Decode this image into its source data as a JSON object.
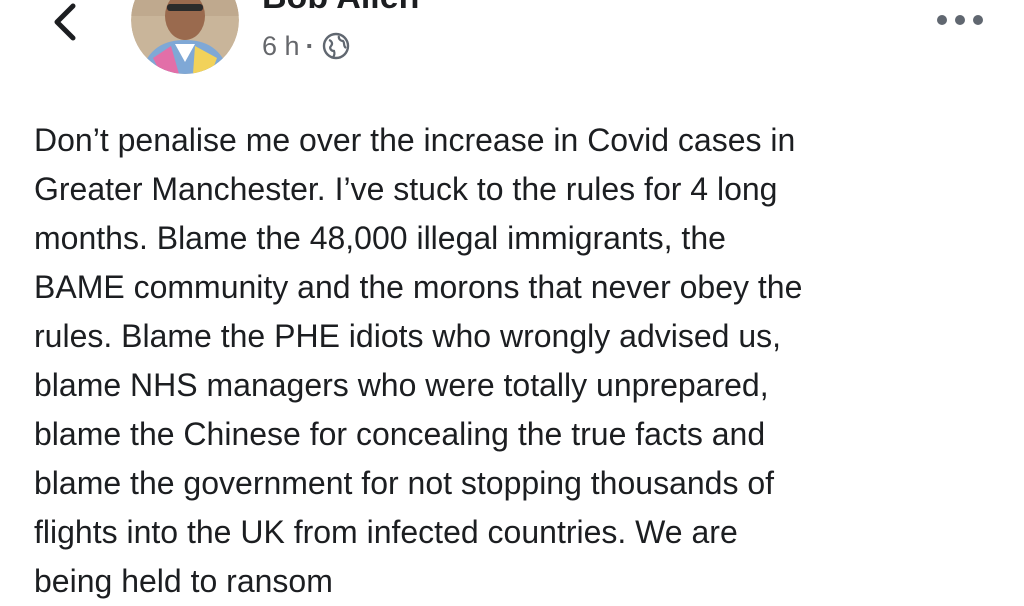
{
  "post": {
    "author": "Bob Allen",
    "timestamp": "6 h",
    "separator": "·",
    "audience_icon": "globe-icon",
    "more_icon": "more-options-icon",
    "back_icon": "chevron-left-icon",
    "body_lines": [
      "Don’t penalise me over the increase in Covid cases in",
      "Greater Manchester. I’ve stuck to the rules for 4 long",
      "months. Blame the 48,000 illegal immigrants, the",
      "BAME community and the morons that never obey the",
      "rules. Blame the PHE idiots who wrongly advised us,",
      "blame NHS managers who were totally unprepared,",
      "blame the Chinese for concealing the true facts and",
      "blame the government for not stopping thousands of",
      "flights into the UK from infected countries. We are",
      "being held to ransom"
    ]
  },
  "colors": {
    "text": "#1c1e21",
    "meta": "#65676b",
    "icon": "#606770",
    "background": "#ffffff"
  }
}
